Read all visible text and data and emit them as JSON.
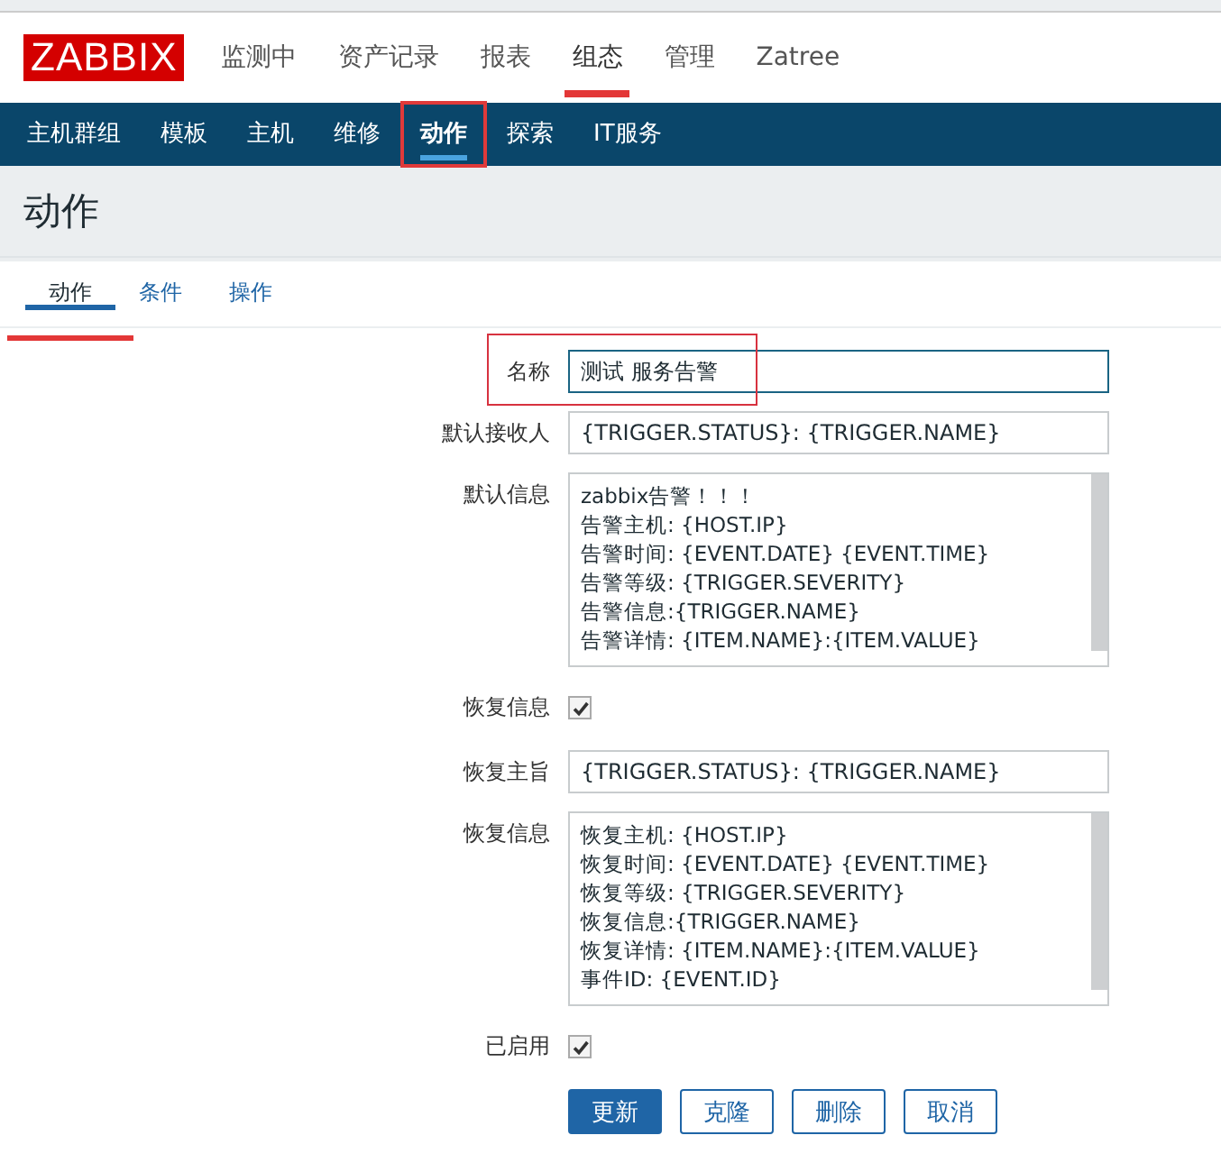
{
  "header": {
    "logo": "ZABBIX",
    "menu": [
      {
        "label": "监测中",
        "selected": false
      },
      {
        "label": "资产记录",
        "selected": false
      },
      {
        "label": "报表",
        "selected": false
      },
      {
        "label": "组态",
        "selected": true
      },
      {
        "label": "管理",
        "selected": false
      },
      {
        "label": "Zatree",
        "selected": false
      }
    ]
  },
  "subnav": [
    {
      "label": "主机群组",
      "selected": false
    },
    {
      "label": "模板",
      "selected": false
    },
    {
      "label": "主机",
      "selected": false
    },
    {
      "label": "维修",
      "selected": false
    },
    {
      "label": "动作",
      "selected": true
    },
    {
      "label": "探索",
      "selected": false
    },
    {
      "label": "IT服务",
      "selected": false
    }
  ],
  "page_title": "动作",
  "tabs": [
    {
      "label": "动作",
      "selected": true
    },
    {
      "label": "条件",
      "selected": false
    },
    {
      "label": "操作",
      "selected": false
    }
  ],
  "form": [
    {
      "kind": "input",
      "label": "名称",
      "value": "测试 服务告警",
      "focused": true,
      "highlighted": true
    },
    {
      "kind": "input",
      "label": "默认接收人",
      "value": "{TRIGGER.STATUS}: {TRIGGER.NAME}",
      "focused": false,
      "highlighted": false
    },
    {
      "kind": "textarea",
      "label": "默认信息",
      "lines": [
        "zabbix告警！！！",
        "告警主机: {HOST.IP}",
        "告警时间: {EVENT.DATE} {EVENT.TIME}",
        "告警等级: {TRIGGER.SEVERITY}",
        "告警信息:{TRIGGER.NAME}",
        "告警详情: {ITEM.NAME}:{ITEM.VALUE}"
      ]
    },
    {
      "kind": "checkbox",
      "label": "恢复信息",
      "checked": true
    },
    {
      "kind": "input",
      "label": "恢复主旨",
      "value": "{TRIGGER.STATUS}: {TRIGGER.NAME}",
      "focused": false,
      "highlighted": false
    },
    {
      "kind": "textarea",
      "label": "恢复信息",
      "lines": [
        "恢复主机: {HOST.IP}",
        "恢复时间: {EVENT.DATE} {EVENT.TIME}",
        "恢复等级: {TRIGGER.SEVERITY}",
        "恢复信息:{TRIGGER.NAME}",
        "恢复详情: {ITEM.NAME}:{ITEM.VALUE}",
        "事件ID: {EVENT.ID}"
      ]
    },
    {
      "kind": "checkbox",
      "label": "已启用",
      "checked": true
    }
  ],
  "buttons": [
    {
      "label": "更新",
      "kind": "primary"
    },
    {
      "label": "克隆",
      "kind": "secondary"
    },
    {
      "label": "删除",
      "kind": "secondary"
    },
    {
      "label": "取消",
      "kind": "secondary"
    }
  ]
}
